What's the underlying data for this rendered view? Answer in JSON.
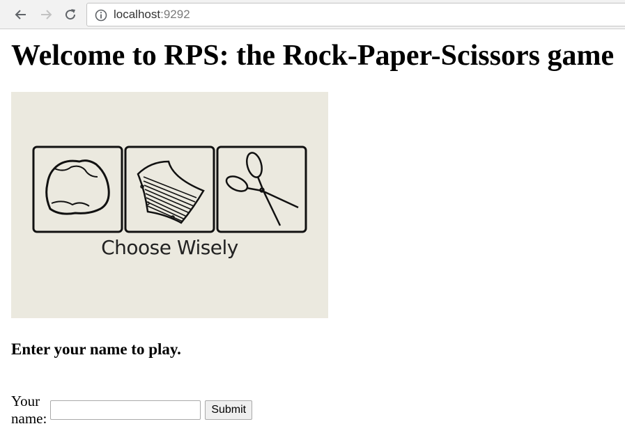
{
  "browser": {
    "url_host": "localhost",
    "url_port": ":9292",
    "icons": {
      "back": "back-arrow-icon",
      "forward": "forward-arrow-icon",
      "reload": "reload-icon",
      "info": "info-icon"
    }
  },
  "page": {
    "heading": "Welcome to RPS: the Rock-Paper-Scissors game",
    "hero_caption": "Choose Wisely",
    "subheading": "Enter your name to play.",
    "form": {
      "label": "Your name:",
      "input_value": "",
      "input_placeholder": "",
      "submit_label": "Submit"
    }
  },
  "colors": {
    "hero_background": "#ebe9df",
    "toolbar_background": "#f2f2f2"
  }
}
